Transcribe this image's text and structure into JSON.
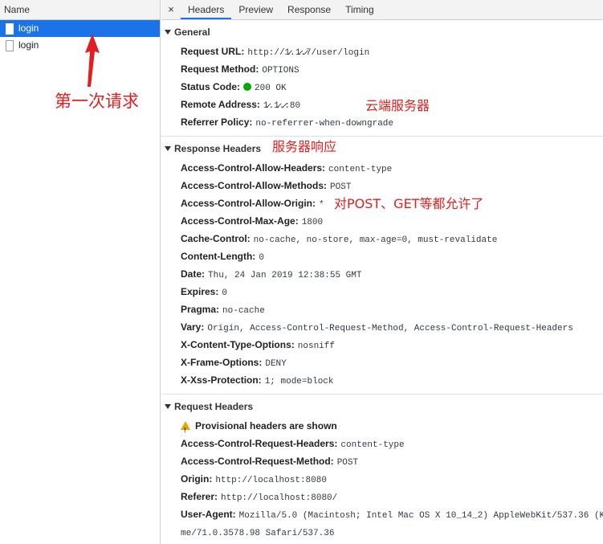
{
  "left": {
    "header": "Name",
    "requests": [
      {
        "name": "login",
        "selected": true
      },
      {
        "name": "login",
        "selected": false
      }
    ]
  },
  "tabs": {
    "close": "×",
    "items": [
      "Headers",
      "Preview",
      "Response",
      "Timing"
    ],
    "active": "Headers"
  },
  "general": {
    "title": "General",
    "rows": [
      {
        "key": "Request URL:",
        "value": "http://1̷̷.1̷̷.̷̷7/user/login"
      },
      {
        "key": "Request Method:",
        "value": "OPTIONS"
      },
      {
        "key": "Status Code:",
        "value": "200 OK"
      },
      {
        "key": "Remote Address:",
        "value": "1̷̷.1̷̷.̷̷:80"
      },
      {
        "key": "Referrer Policy:",
        "value": "no-referrer-when-downgrade"
      }
    ]
  },
  "response_headers": {
    "title": "Response Headers",
    "rows": [
      {
        "key": "Access-Control-Allow-Headers:",
        "value": "content-type"
      },
      {
        "key": "Access-Control-Allow-Methods:",
        "value": "POST"
      },
      {
        "key": "Access-Control-Allow-Origin:",
        "value": "*"
      },
      {
        "key": "Access-Control-Max-Age:",
        "value": "1800"
      },
      {
        "key": "Cache-Control:",
        "value": "no-cache, no-store, max-age=0, must-revalidate"
      },
      {
        "key": "Content-Length:",
        "value": "0"
      },
      {
        "key": "Date:",
        "value": "Thu, 24 Jan 2019 12:38:55 GMT"
      },
      {
        "key": "Expires:",
        "value": "0"
      },
      {
        "key": "Pragma:",
        "value": "no-cache"
      },
      {
        "key": "Vary:",
        "value": "Origin, Access-Control-Request-Method, Access-Control-Request-Headers"
      },
      {
        "key": "X-Content-Type-Options:",
        "value": "nosniff"
      },
      {
        "key": "X-Frame-Options:",
        "value": "DENY"
      },
      {
        "key": "X-Xss-Protection:",
        "value": "1; mode=block"
      }
    ]
  },
  "request_headers": {
    "title": "Request Headers",
    "warning": "Provisional headers are shown",
    "rows": [
      {
        "key": "Access-Control-Request-Headers:",
        "value": "content-type"
      },
      {
        "key": "Access-Control-Request-Method:",
        "value": "POST"
      },
      {
        "key": "Origin:",
        "value": "http://localhost:8080"
      },
      {
        "key": "Referer:",
        "value": "http://localhost:8080/"
      },
      {
        "key": "User-Agent:",
        "value": "Mozilla/5.0 (Macintosh; Intel Mac OS X 10_14_2) AppleWebKit/537.36 (K"
      }
    ],
    "ua_wrap": "me/71.0.3578.98 Safari/537.36"
  },
  "annotations": {
    "first_request": "第一次请求",
    "cloud_server": "云端服务器",
    "server_response": "服务器响应",
    "allow_methods": "对POST、GET等都允许了"
  },
  "colors": {
    "accent": "#1a73e8",
    "annotation": "#e02020",
    "status_ok": "#00aa00"
  }
}
